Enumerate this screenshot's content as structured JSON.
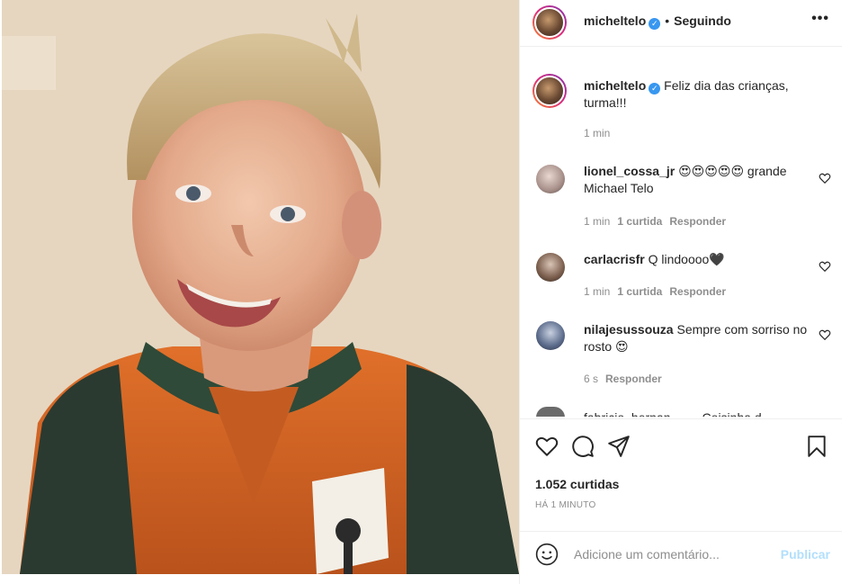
{
  "header": {
    "username": "micheltelo",
    "verified_icon": "verified-badge-icon",
    "separator": "•",
    "follow_status": "Seguindo",
    "more_label": "•••"
  },
  "caption": {
    "username": "micheltelo",
    "text": "Feliz dia das crianças, turma!!!",
    "time": "1 min"
  },
  "comments": [
    {
      "username": "lionel_cossa_jr",
      "text": "😍😍😍😍😍 grande Michael Telo",
      "time": "1 min",
      "likes": "1 curtida",
      "reply": "Responder"
    },
    {
      "username": "carlacrisfr",
      "text": "Q lindoooo🖤",
      "time": "1 min",
      "likes": "1 curtida",
      "reply": "Responder"
    },
    {
      "username": "nilajesussouza",
      "text": "Sempre com sorriso no rosto 😍",
      "time": "6 s",
      "reply": "Responder"
    }
  ],
  "cut_comment_text": "fabricio_hernan____ Coisinha d",
  "actions": {
    "like_icon": "heart-icon",
    "comment_icon": "comment-icon",
    "share_icon": "share-icon",
    "save_icon": "bookmark-icon"
  },
  "likes": "1.052 curtidas",
  "posted_ago": "HÁ 1 MINUTO",
  "add_comment": {
    "placeholder": "Adicione um comentário...",
    "publish_label": "Publicar",
    "emoji_icon": "smiley-icon"
  },
  "colors": {
    "accent": "#3897f0",
    "publish_disabled": "#b2dffc",
    "text": "#262626",
    "muted": "#8e8e8e"
  }
}
